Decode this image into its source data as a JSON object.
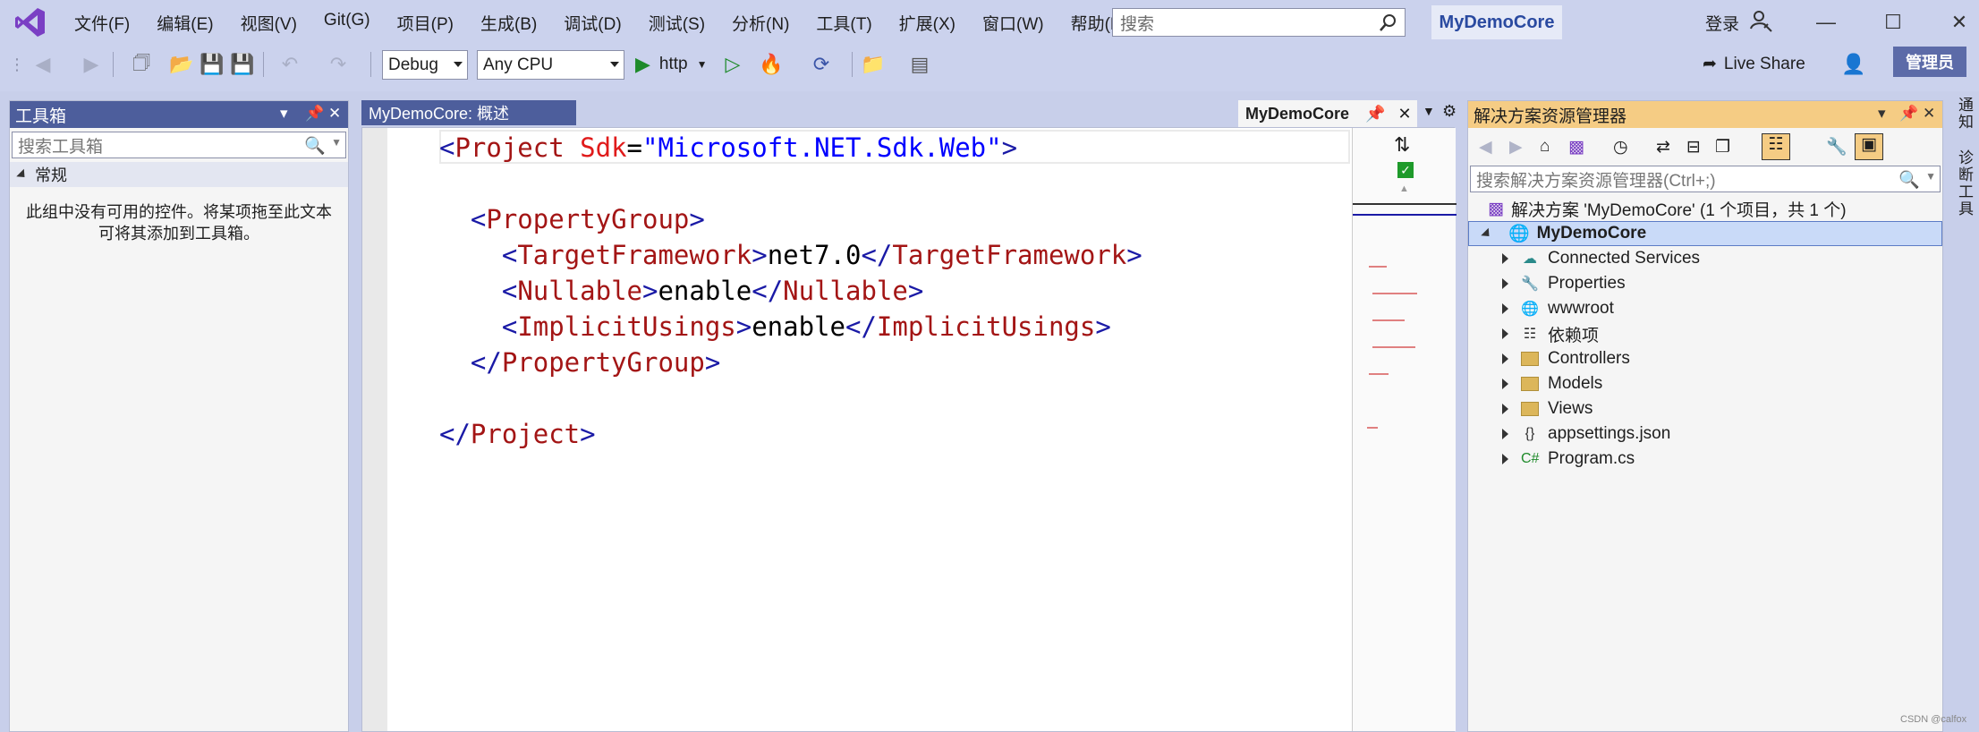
{
  "menu": [
    "文件(F)",
    "编辑(E)",
    "视图(V)",
    "Git(G)",
    "项目(P)",
    "生成(B)",
    "调试(D)",
    "测试(S)",
    "分析(N)",
    "工具(T)",
    "扩展(X)",
    "窗口(W)",
    "帮助(H)"
  ],
  "titlebar": {
    "search_placeholder": "搜索",
    "solution_name": "MyDemoCore",
    "login_label": "登录"
  },
  "toolbar": {
    "config": "Debug",
    "platform": "Any CPU",
    "run_label": "http",
    "live_share": "Live Share",
    "admin": "管理员"
  },
  "toolbox": {
    "title": "工具箱",
    "search_placeholder": "搜索工具箱",
    "group": "常规",
    "empty_text": "此组中没有可用的控件。将某项拖至此文本可将其添加到工具箱。"
  },
  "editor": {
    "inactive_tab": "MyDemoCore: 概述",
    "active_tab": "MyDemoCore",
    "lines": [
      [
        [
          "bracket",
          "<"
        ],
        [
          "tag",
          "Project"
        ],
        [
          "text",
          " "
        ],
        [
          "attr",
          "Sdk"
        ],
        [
          "text",
          "="
        ],
        [
          "val",
          "\"Microsoft.NET.Sdk.Web\""
        ],
        [
          "bracket",
          ">"
        ]
      ],
      [],
      [
        [
          "text",
          "  "
        ],
        [
          "bracket",
          "<"
        ],
        [
          "tag",
          "PropertyGroup"
        ],
        [
          "bracket",
          ">"
        ]
      ],
      [
        [
          "text",
          "    "
        ],
        [
          "bracket",
          "<"
        ],
        [
          "tag",
          "TargetFramework"
        ],
        [
          "bracket",
          ">"
        ],
        [
          "text",
          "net7.0"
        ],
        [
          "bracket",
          "</"
        ],
        [
          "tag",
          "TargetFramework"
        ],
        [
          "bracket",
          ">"
        ]
      ],
      [
        [
          "text",
          "    "
        ],
        [
          "bracket",
          "<"
        ],
        [
          "tag",
          "Nullable"
        ],
        [
          "bracket",
          ">"
        ],
        [
          "text",
          "enable"
        ],
        [
          "bracket",
          "</"
        ],
        [
          "tag",
          "Nullable"
        ],
        [
          "bracket",
          ">"
        ]
      ],
      [
        [
          "text",
          "    "
        ],
        [
          "bracket",
          "<"
        ],
        [
          "tag",
          "ImplicitUsings"
        ],
        [
          "bracket",
          ">"
        ],
        [
          "text",
          "enable"
        ],
        [
          "bracket",
          "</"
        ],
        [
          "tag",
          "ImplicitUsings"
        ],
        [
          "bracket",
          ">"
        ]
      ],
      [
        [
          "text",
          "  "
        ],
        [
          "bracket",
          "</"
        ],
        [
          "tag",
          "PropertyGroup"
        ],
        [
          "bracket",
          ">"
        ]
      ],
      [],
      [
        [
          "bracket",
          "</"
        ],
        [
          "tag",
          "Project"
        ],
        [
          "bracket",
          ">"
        ]
      ]
    ]
  },
  "solution_explorer": {
    "title": "解决方案资源管理器",
    "search_placeholder": "搜索解决方案资源管理器(Ctrl+;)",
    "solution_label": "解决方案 'MyDemoCore' (1 个项目，共 1 个)",
    "project": "MyDemoCore",
    "items": [
      {
        "label": "Connected Services",
        "icon": "connected-services-icon"
      },
      {
        "label": "Properties",
        "icon": "properties-icon"
      },
      {
        "label": "wwwroot",
        "icon": "globe-icon"
      },
      {
        "label": "依赖项",
        "icon": "dependencies-icon"
      },
      {
        "label": "Controllers",
        "icon": "folder-icon"
      },
      {
        "label": "Models",
        "icon": "folder-icon"
      },
      {
        "label": "Views",
        "icon": "folder-icon"
      },
      {
        "label": "appsettings.json",
        "icon": "json-icon"
      },
      {
        "label": "Program.cs",
        "icon": "csharp-icon"
      }
    ]
  },
  "side_tabs": [
    "通知",
    "诊断工具"
  ],
  "watermark": "CSDN @calfox"
}
